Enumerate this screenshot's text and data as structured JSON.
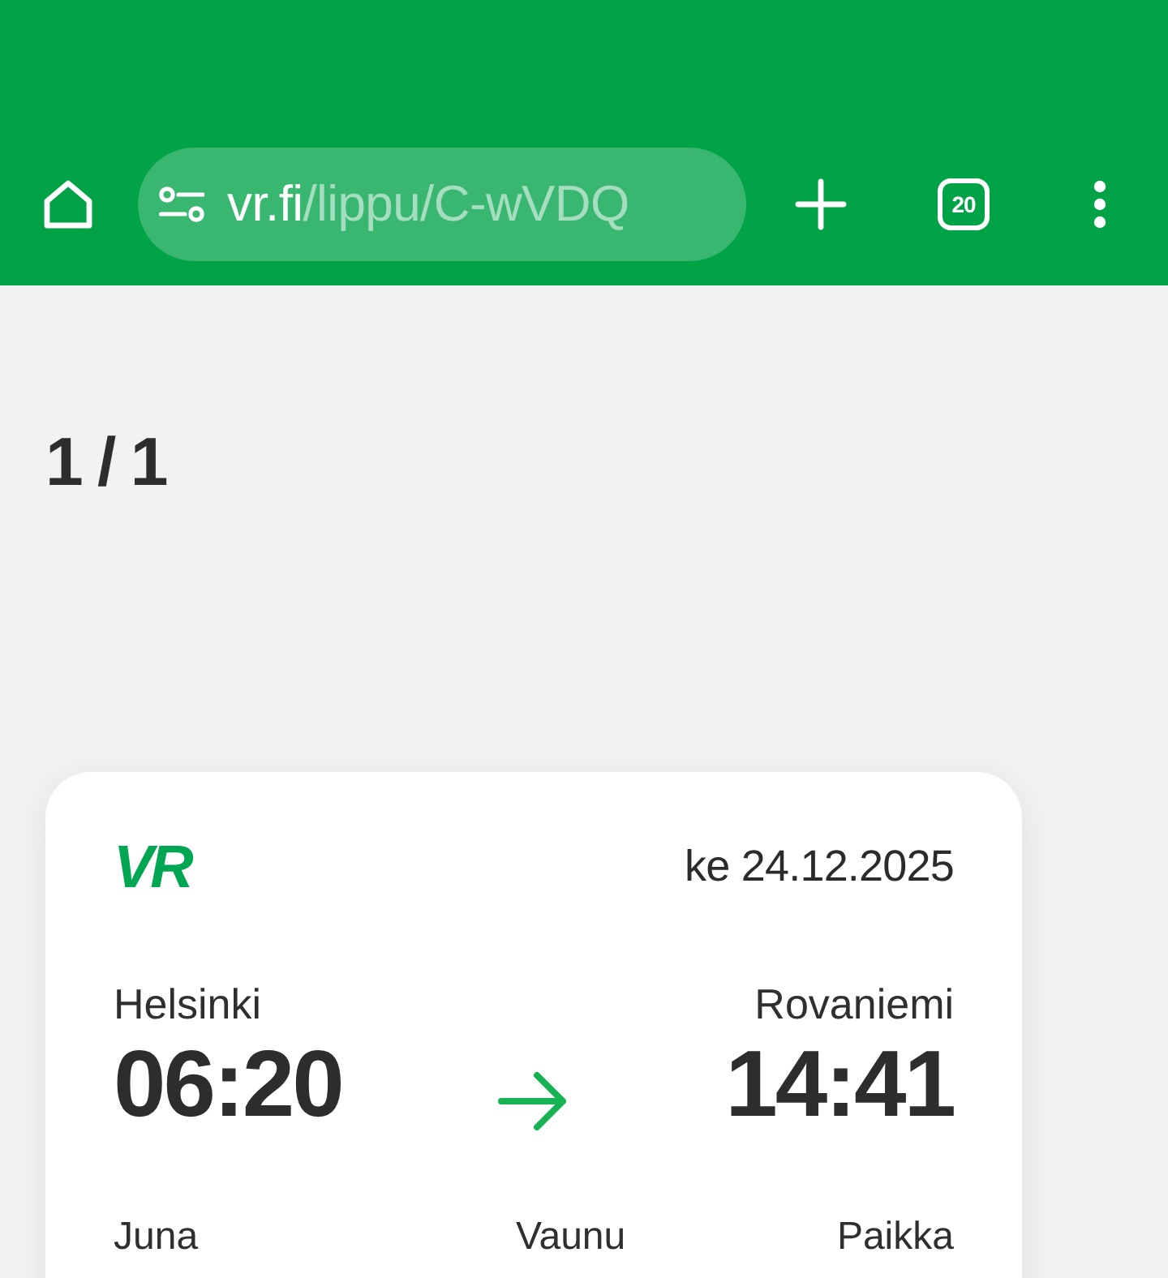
{
  "browser_toolbar": {
    "url": {
      "host": "vr.fi",
      "path": "/lippu/C-wVDQ"
    },
    "tab_count": "20"
  },
  "pager": "1 / 1",
  "ticket": {
    "logo": "VR",
    "date": "ke 24.12.2025",
    "departure": {
      "station": "Helsinki",
      "time": "06:20"
    },
    "arrival": {
      "station": "Rovaniemi",
      "time": "14:41"
    },
    "details": [
      "Juna",
      "Vaunu",
      "Paikka"
    ]
  }
}
